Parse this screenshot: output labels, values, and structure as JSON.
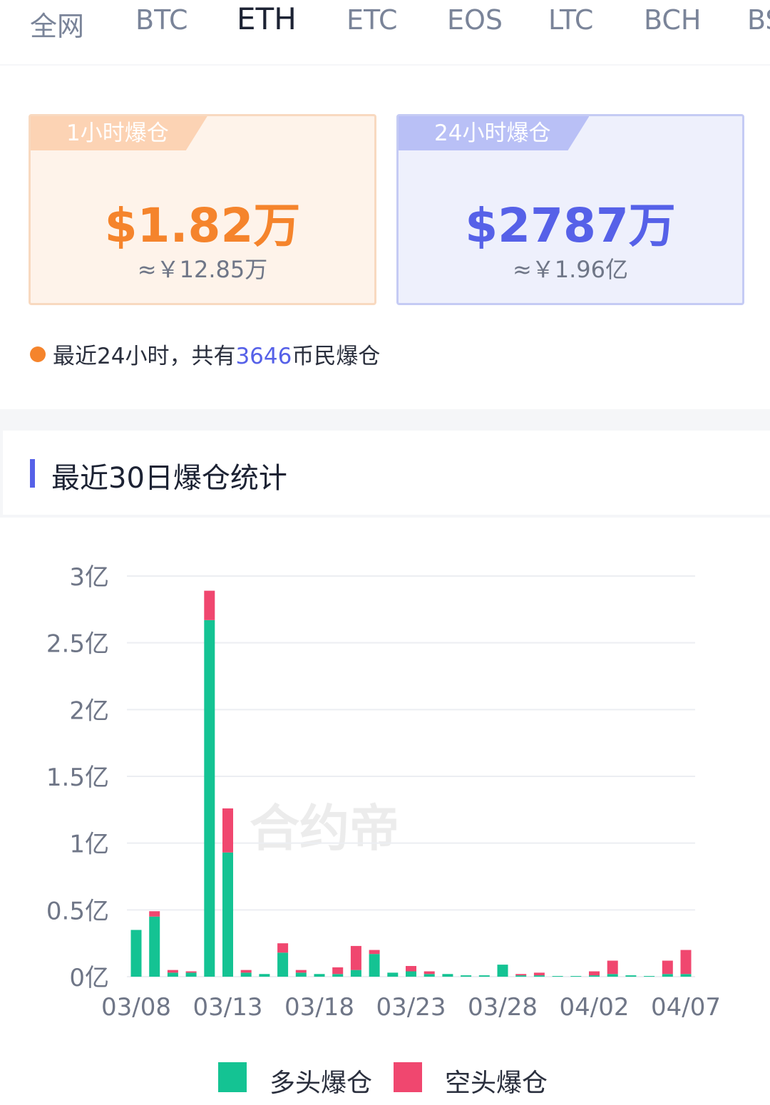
{
  "tabs": [
    "全网",
    "BTC",
    "ETH",
    "ETC",
    "EOS",
    "LTC",
    "BCH",
    "BSV"
  ],
  "active_tab": "ETH",
  "cards": {
    "hour1": {
      "label": "1小时爆仓",
      "usd": "$1.82万",
      "cny": "≈￥12.85万"
    },
    "hour24": {
      "label": "24小时爆仓",
      "usd": "$2787万",
      "cny": "≈￥1.96亿"
    }
  },
  "note": {
    "prefix": "最近24小时，共有",
    "count": "3646",
    "suffix": "币民爆仓"
  },
  "section_title": "最近30日爆仓统计",
  "watermark": "合约帝",
  "colors": {
    "long": "#14c393",
    "short": "#f0476f",
    "accent": "#5661e8",
    "orange": "#f5842c"
  },
  "chart_data": {
    "type": "bar",
    "stacked": true,
    "unit": "亿",
    "ylim": [
      0,
      3
    ],
    "yticks": [
      "0亿",
      "0.5亿",
      "1亿",
      "1.5亿",
      "2亿",
      "2.5亿",
      "3亿"
    ],
    "xtick_labels": [
      "03/08",
      "03/13",
      "03/18",
      "03/23",
      "03/28",
      "04/02",
      "04/07"
    ],
    "categories": [
      "03/08",
      "03/09",
      "03/10",
      "03/11",
      "03/12",
      "03/13",
      "03/14",
      "03/15",
      "03/16",
      "03/17",
      "03/18",
      "03/19",
      "03/20",
      "03/21",
      "03/22",
      "03/23",
      "03/24",
      "03/25",
      "03/26",
      "03/27",
      "03/28",
      "03/29",
      "03/30",
      "03/31",
      "04/01",
      "04/02",
      "04/03",
      "04/04",
      "04/05",
      "04/06",
      "04/07"
    ],
    "series": [
      {
        "name": "多头爆仓",
        "values": [
          0.35,
          0.45,
          0.03,
          0.03,
          2.67,
          0.93,
          0.03,
          0.02,
          0.18,
          0.03,
          0.02,
          0.02,
          0.05,
          0.17,
          0.03,
          0.04,
          0.02,
          0.02,
          0.01,
          0.01,
          0.09,
          0.01,
          0.01,
          0.005,
          0.005,
          0.01,
          0.02,
          0.01,
          0.005,
          0.02,
          0.02
        ]
      },
      {
        "name": "空头爆仓",
        "values": [
          0.0,
          0.04,
          0.02,
          0.01,
          0.22,
          0.33,
          0.02,
          0.0,
          0.07,
          0.02,
          0.0,
          0.05,
          0.18,
          0.03,
          0.0,
          0.04,
          0.02,
          0.0,
          0.0,
          0.0,
          0.0,
          0.01,
          0.02,
          0.0,
          0.0,
          0.03,
          0.1,
          0.0,
          0.0,
          0.1,
          0.18
        ]
      }
    ]
  }
}
